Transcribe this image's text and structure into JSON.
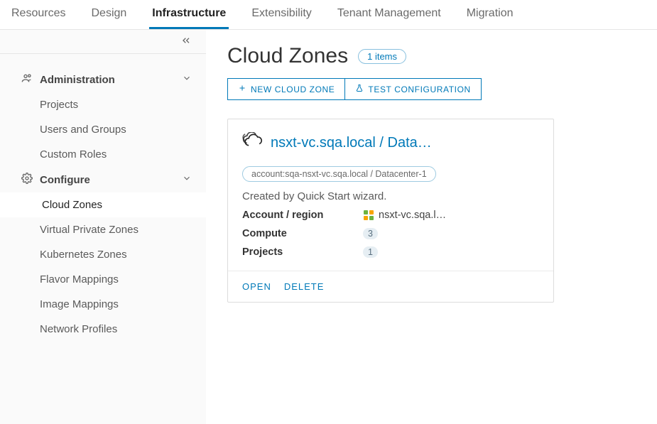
{
  "topnav": {
    "tabs": [
      "Resources",
      "Design",
      "Infrastructure",
      "Extensibility",
      "Tenant Management",
      "Migration"
    ],
    "activeIndex": 2
  },
  "sidebar": {
    "sections": [
      {
        "label": "Administration",
        "items": [
          "Projects",
          "Users and Groups",
          "Custom Roles"
        ]
      },
      {
        "label": "Configure",
        "items": [
          "Cloud Zones",
          "Virtual Private Zones",
          "Kubernetes Zones",
          "Flavor Mappings",
          "Image Mappings",
          "Network Profiles"
        ],
        "selectedIndex": 0
      }
    ]
  },
  "page": {
    "title": "Cloud Zones",
    "countLabel": "1 items",
    "btnNew": "New Cloud Zone",
    "btnTest": "Test Configuration"
  },
  "card": {
    "title": "nsxt-vc.sqa.local / Data…",
    "tag": "account:sqa-nsxt-vc.sqa.local / Datacenter-1",
    "desc": "Created by Quick Start wizard.",
    "rows": {
      "accountRegionLabel": "Account / region",
      "accountRegionValue": "nsxt-vc.sqa.l…",
      "computeLabel": "Compute",
      "computeValue": "3",
      "projectsLabel": "Projects",
      "projectsValue": "1"
    },
    "openLabel": "Open",
    "deleteLabel": "Delete"
  }
}
